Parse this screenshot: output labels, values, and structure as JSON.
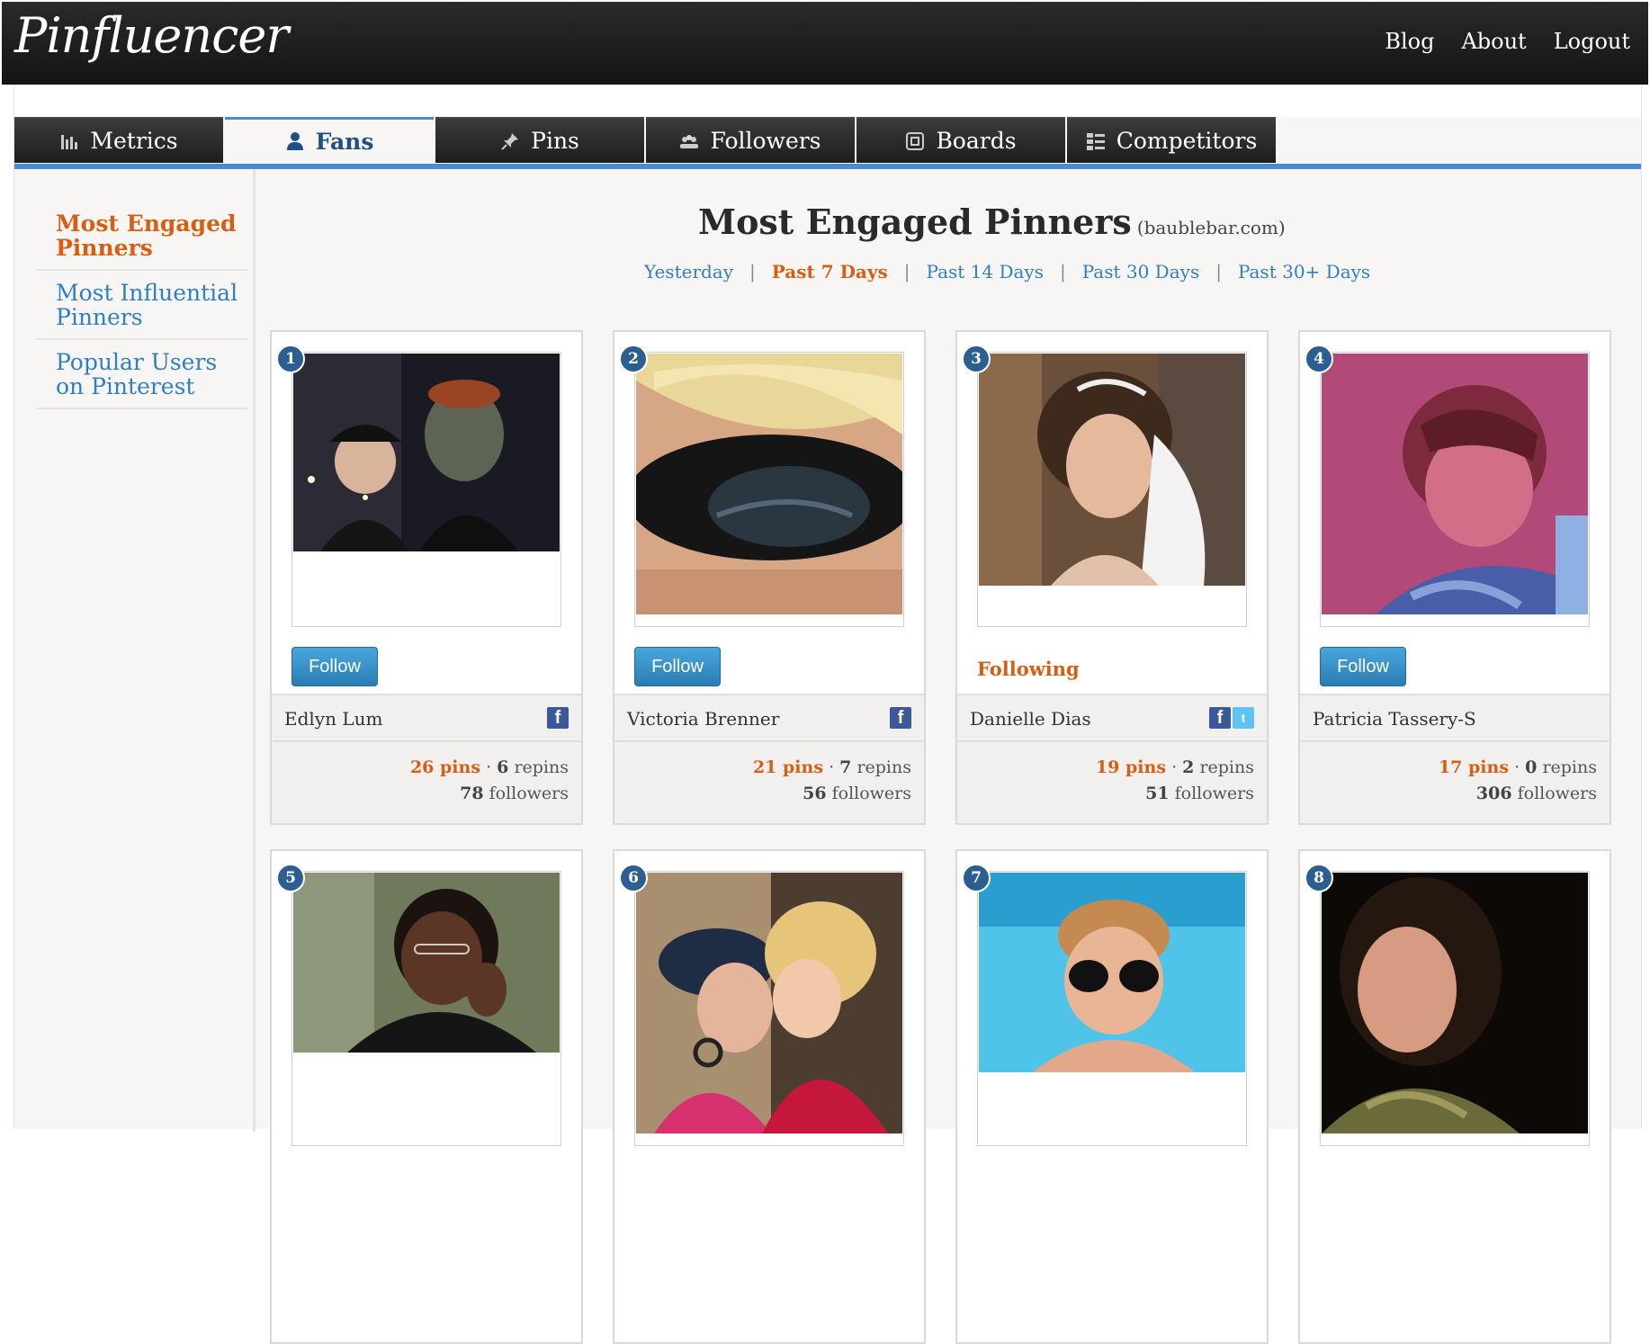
{
  "app": {
    "logo": "Pinfluencer"
  },
  "topnav": [
    "Blog",
    "About",
    "Logout"
  ],
  "tabs": [
    {
      "label": "Metrics",
      "icon": "bar-chart-icon",
      "active": false
    },
    {
      "label": "Fans",
      "icon": "person-icon",
      "active": true
    },
    {
      "label": "Pins",
      "icon": "pushpin-icon",
      "active": false
    },
    {
      "label": "Followers",
      "icon": "people-icon",
      "active": false
    },
    {
      "label": "Boards",
      "icon": "board-icon",
      "active": false
    },
    {
      "label": "Competitors",
      "icon": "list-icon",
      "active": false
    }
  ],
  "sidebar": {
    "items": [
      {
        "label": "Most Engaged Pinners",
        "active": true
      },
      {
        "label": "Most Influential Pinners",
        "active": false
      },
      {
        "label": "Popular Users on Pinterest",
        "active": false
      }
    ]
  },
  "main": {
    "title": "Most Engaged Pinners",
    "domain": "(baublebar.com)",
    "periods": [
      {
        "label": "Yesterday",
        "active": false
      },
      {
        "label": "Past 7 Days",
        "active": true
      },
      {
        "label": "Past 14 Days",
        "active": false
      },
      {
        "label": "Past 30 Days",
        "active": false
      },
      {
        "label": "Past 30+ Days",
        "active": false
      }
    ]
  },
  "follow_label": "Follow",
  "following_label": "Following",
  "pinners": [
    {
      "rank": "1",
      "name": "Edlyn Lum",
      "pins": "26 pins",
      "repins": "6",
      "repins_label": "repins",
      "followers": "78",
      "followers_label": "followers",
      "status": "follow",
      "social": [
        "facebook"
      ]
    },
    {
      "rank": "2",
      "name": "Victoria Brenner",
      "pins": "21 pins",
      "repins": "7",
      "repins_label": "repins",
      "followers": "56",
      "followers_label": "followers",
      "status": "follow",
      "social": [
        "facebook"
      ]
    },
    {
      "rank": "3",
      "name": "Danielle Dias",
      "pins": "19 pins",
      "repins": "2",
      "repins_label": "repins",
      "followers": "51",
      "followers_label": "followers",
      "status": "following",
      "social": [
        "facebook",
        "twitter"
      ]
    },
    {
      "rank": "4",
      "name": "Patricia Tassery-S",
      "pins": "17 pins",
      "repins": "0",
      "repins_label": "repins",
      "followers": "306",
      "followers_label": "followers",
      "status": "follow",
      "social": []
    },
    {
      "rank": "5",
      "name": "",
      "status": "none",
      "social": []
    },
    {
      "rank": "6",
      "name": "",
      "status": "none",
      "social": []
    },
    {
      "rank": "7",
      "name": "",
      "status": "none",
      "social": []
    },
    {
      "rank": "8",
      "name": "",
      "status": "none",
      "social": []
    }
  ],
  "colors": {
    "accent_blue": "#2f7fc5",
    "accent_orange": "#d75e12",
    "tab_rule": "#4a8ccd"
  }
}
